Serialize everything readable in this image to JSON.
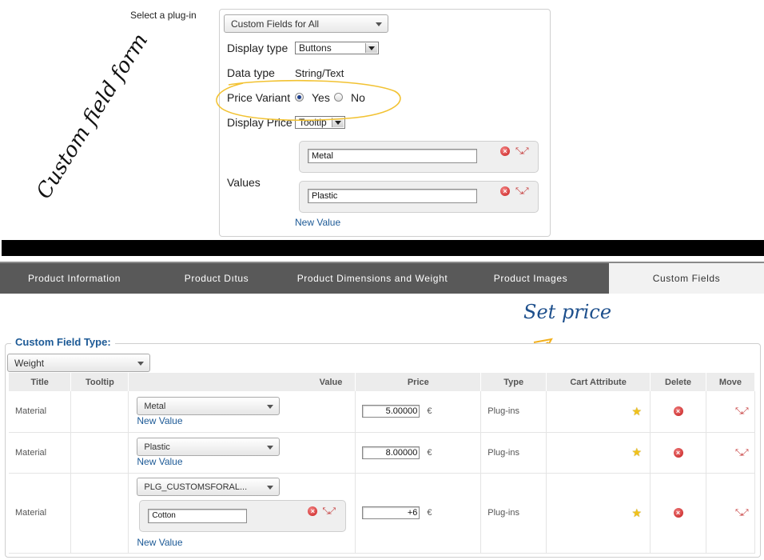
{
  "annotations": {
    "custom_field_form": "Custom field form",
    "set_price": "Set price"
  },
  "form": {
    "plugin_label": "Select a plug-in",
    "plugin_selected": "Custom Fields for All",
    "display_type_label": "Display type",
    "display_type_value": "Buttons",
    "data_type_label": "Data type",
    "data_type_value": "String/Text",
    "price_variant_label": "Price Variant",
    "price_variant_yes": "Yes",
    "price_variant_no": "No",
    "price_variant_selected": "Yes",
    "display_price_label": "Display Price",
    "display_price_value": "Tooltip",
    "values_label": "Values",
    "values": [
      "Metal",
      "Plastic"
    ],
    "new_value_link": "New Value"
  },
  "tabs": [
    {
      "label": "Product Information",
      "active": false
    },
    {
      "label": "Product Dıtus",
      "active": false
    },
    {
      "label": "Product Dimensions and Weight",
      "active": false
    },
    {
      "label": "Product Images",
      "active": false
    },
    {
      "label": "Custom Fields",
      "active": true
    }
  ],
  "custom_fields": {
    "legend": "Custom Field Type:",
    "type_selected": "Weight",
    "columns": [
      "Title",
      "Tooltip",
      "Value",
      "Price",
      "Type",
      "Cart Attribute",
      "Delete",
      "Move"
    ],
    "rows": [
      {
        "title": "Material",
        "tooltip": "",
        "value_select": "Metal",
        "new_value": "New Value",
        "price": "5.00000",
        "currency": "€",
        "type": "Plug-ins"
      },
      {
        "title": "Material",
        "tooltip": "",
        "value_select": "Plastic",
        "new_value": "New Value",
        "price": "8.00000",
        "currency": "€",
        "type": "Plug-ins"
      },
      {
        "title": "Material",
        "tooltip": "",
        "value_select": "PLG_CUSTOMSFORAL...",
        "sub_value": "Cotton",
        "new_value": "New Value",
        "price": "+6",
        "currency": "€",
        "type": "Plug-ins"
      }
    ]
  },
  "colors": {
    "link": "#1d5a96",
    "tab_bar": "#595959",
    "annotation_circle": "#f2c232",
    "arrow": "#f2b01e"
  },
  "icons": [
    "delete-icon",
    "move-icon",
    "star-icon",
    "dropdown-arrow-icon",
    "radio-icon"
  ]
}
